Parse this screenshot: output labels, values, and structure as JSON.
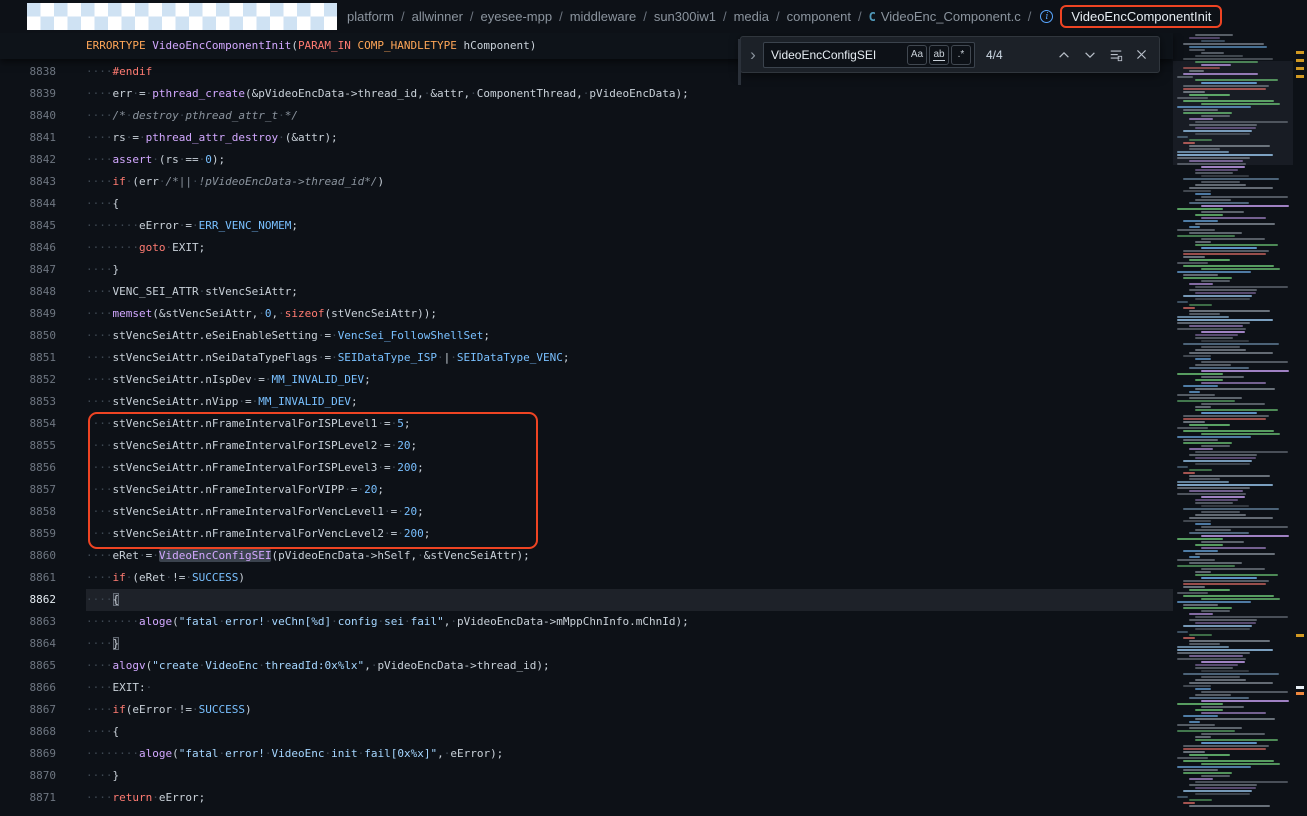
{
  "colors": {
    "background": "#0d1117",
    "annotation_orange": "#ee4423",
    "keyword": "#ff7b72",
    "function": "#d2a8ff",
    "constant": "#79c0ff",
    "string": "#a5d6ff",
    "comment": "#8b949e"
  },
  "topbar": {
    "separator": "/",
    "breadcrumb_items": [
      "platform",
      "allwinner",
      "eyesee-mpp",
      "middleware",
      "sun300iw1",
      "media",
      "component"
    ],
    "file": "VideoEnc_Component.c",
    "file_icon": "C",
    "symbol_icon": "i",
    "symbol": "VideoEncComponentInit"
  },
  "sticky_header": {
    "tokens": [
      [
        "t",
        "ERRORTYPE"
      ],
      [
        "d",
        " "
      ],
      [
        "f",
        "VideoEncComponentInit"
      ],
      [
        "d",
        "("
      ],
      [
        "k",
        "PARAM_IN"
      ],
      [
        "d",
        " "
      ],
      [
        "t",
        "COMP_HANDLETYPE"
      ],
      [
        "d",
        " hComponent)"
      ]
    ]
  },
  "find": {
    "query": "VideoEncConfigSEI",
    "matches": "4/4",
    "match_case": "Aa",
    "whole_word": "ab",
    "regex": ".*",
    "toggle_replace_glyph": "›"
  },
  "editor": {
    "current_line": 8862,
    "lines": [
      {
        "n": 8838,
        "t": [
          [
            "d",
            "    "
          ],
          [
            "k",
            "#endif"
          ]
        ]
      },
      {
        "n": 8839,
        "t": [
          [
            "d",
            "    err = "
          ],
          [
            "f",
            "pthread_create"
          ],
          [
            "d",
            "(&pVideoEncData->thread_id, &attr, ComponentThread, pVideoEncData);"
          ]
        ]
      },
      {
        "n": 8840,
        "t": [
          [
            "d",
            "    "
          ],
          [
            "c",
            "/* destroy pthread_attr_t */"
          ]
        ]
      },
      {
        "n": 8841,
        "t": [
          [
            "d",
            "    rs = "
          ],
          [
            "f",
            "pthread_attr_destroy"
          ],
          [
            "d",
            " (&attr);"
          ]
        ]
      },
      {
        "n": 8842,
        "t": [
          [
            "d",
            "    "
          ],
          [
            "f",
            "assert"
          ],
          [
            "d",
            " (rs == "
          ],
          [
            "n",
            "0"
          ],
          [
            "d",
            ");"
          ]
        ]
      },
      {
        "n": 8843,
        "t": [
          [
            "d",
            "    "
          ],
          [
            "k",
            "if"
          ],
          [
            "d",
            " (err "
          ],
          [
            "c",
            "/*|| !pVideoEncData->thread_id*/"
          ],
          [
            "d",
            ")"
          ]
        ]
      },
      {
        "n": 8844,
        "t": [
          [
            "d",
            "    {"
          ]
        ]
      },
      {
        "n": 8845,
        "t": [
          [
            "d",
            "        eError = "
          ],
          [
            "n",
            "ERR_VENC_NOMEM"
          ],
          [
            "d",
            ";"
          ]
        ]
      },
      {
        "n": 8846,
        "t": [
          [
            "d",
            "        "
          ],
          [
            "k",
            "goto"
          ],
          [
            "d",
            " EXIT;"
          ]
        ]
      },
      {
        "n": 8847,
        "t": [
          [
            "d",
            "    }"
          ]
        ]
      },
      {
        "n": 8848,
        "t": [
          [
            "d",
            "    VENC_SEI_ATTR stVencSeiAttr;"
          ]
        ]
      },
      {
        "n": 8849,
        "t": [
          [
            "d",
            "    "
          ],
          [
            "f",
            "memset"
          ],
          [
            "d",
            "(&stVencSeiAttr, "
          ],
          [
            "n",
            "0"
          ],
          [
            "d",
            ", "
          ],
          [
            "k",
            "sizeof"
          ],
          [
            "d",
            "(stVencSeiAttr));"
          ]
        ]
      },
      {
        "n": 8850,
        "t": [
          [
            "d",
            "    stVencSeiAttr.eSeiEnableSetting = "
          ],
          [
            "n",
            "VencSei_FollowShellSet"
          ],
          [
            "d",
            ";"
          ]
        ]
      },
      {
        "n": 8851,
        "t": [
          [
            "d",
            "    stVencSeiAttr.nSeiDataTypeFlags = "
          ],
          [
            "n",
            "SEIDataType_ISP"
          ],
          [
            "d",
            " | "
          ],
          [
            "n",
            "SEIDataType_VENC"
          ],
          [
            "d",
            ";"
          ]
        ]
      },
      {
        "n": 8852,
        "t": [
          [
            "d",
            "    stVencSeiAttr.nIspDev = "
          ],
          [
            "n",
            "MM_INVALID_DEV"
          ],
          [
            "d",
            ";"
          ]
        ]
      },
      {
        "n": 8853,
        "t": [
          [
            "d",
            "    stVencSeiAttr.nVipp = "
          ],
          [
            "n",
            "MM_INVALID_DEV"
          ],
          [
            "d",
            ";"
          ]
        ]
      },
      {
        "n": 8854,
        "t": [
          [
            "d",
            "    stVencSeiAttr.nFrameIntervalForISPLevel1 = "
          ],
          [
            "n",
            "5"
          ],
          [
            "d",
            ";"
          ]
        ]
      },
      {
        "n": 8855,
        "t": [
          [
            "d",
            "    stVencSeiAttr.nFrameIntervalForISPLevel2 = "
          ],
          [
            "n",
            "20"
          ],
          [
            "d",
            ";"
          ]
        ]
      },
      {
        "n": 8856,
        "t": [
          [
            "d",
            "    stVencSeiAttr.nFrameIntervalForISPLevel3 = "
          ],
          [
            "n",
            "200"
          ],
          [
            "d",
            ";"
          ]
        ]
      },
      {
        "n": 8857,
        "t": [
          [
            "d",
            "    stVencSeiAttr.nFrameIntervalForVIPP = "
          ],
          [
            "n",
            "20"
          ],
          [
            "d",
            ";"
          ]
        ]
      },
      {
        "n": 8858,
        "t": [
          [
            "d",
            "    stVencSeiAttr.nFrameIntervalForVencLevel1 = "
          ],
          [
            "n",
            "20"
          ],
          [
            "d",
            ";"
          ]
        ]
      },
      {
        "n": 8859,
        "t": [
          [
            "d",
            "    stVencSeiAttr.nFrameIntervalForVencLevel2 = "
          ],
          [
            "n",
            "200"
          ],
          [
            "d",
            ";"
          ]
        ]
      },
      {
        "n": 8860,
        "t": [
          [
            "d",
            "    eRet = "
          ],
          [
            "f m",
            "VideoEncConfigSEI"
          ],
          [
            "d",
            "(pVideoEncData->hSelf, &stVencSeiAttr);"
          ]
        ]
      },
      {
        "n": 8861,
        "t": [
          [
            "d",
            "    "
          ],
          [
            "k",
            "if"
          ],
          [
            "d",
            " (eRet != "
          ],
          [
            "n",
            "SUCCESS"
          ],
          [
            "d",
            ")"
          ]
        ]
      },
      {
        "n": 8862,
        "t": [
          [
            "d",
            "    "
          ],
          [
            "d bm",
            "{"
          ]
        ]
      },
      {
        "n": 8863,
        "t": [
          [
            "d",
            "        "
          ],
          [
            "f",
            "aloge"
          ],
          [
            "d",
            "("
          ],
          [
            "s",
            "\"fatal error! veChn[%d] config sei fail\""
          ],
          [
            "d",
            ", pVideoEncData->mMppChnInfo.mChnId);"
          ]
        ]
      },
      {
        "n": 8864,
        "t": [
          [
            "d",
            "    "
          ],
          [
            "d bm",
            "}"
          ]
        ]
      },
      {
        "n": 8865,
        "t": [
          [
            "d",
            "    "
          ],
          [
            "f",
            "alogv"
          ],
          [
            "d",
            "("
          ],
          [
            "s",
            "\"create VideoEnc threadId:0x%lx\""
          ],
          [
            "d",
            ", pVideoEncData->thread_id);"
          ]
        ]
      },
      {
        "n": 8866,
        "t": [
          [
            "d",
            "    EXIT: "
          ]
        ]
      },
      {
        "n": 8867,
        "t": [
          [
            "d",
            "    "
          ],
          [
            "k",
            "if"
          ],
          [
            "d",
            "(eError != "
          ],
          [
            "n",
            "SUCCESS"
          ],
          [
            "d",
            ")"
          ]
        ]
      },
      {
        "n": 8868,
        "t": [
          [
            "d",
            "    {"
          ]
        ]
      },
      {
        "n": 8869,
        "t": [
          [
            "d",
            "        "
          ],
          [
            "f",
            "aloge"
          ],
          [
            "d",
            "("
          ],
          [
            "s",
            "\"fatal error! VideoEnc init fail[0x%x]\""
          ],
          [
            "d",
            ", eError);"
          ]
        ]
      },
      {
        "n": 8870,
        "t": [
          [
            "d",
            "    }"
          ]
        ]
      },
      {
        "n": 8871,
        "t": [
          [
            "d",
            "    "
          ],
          [
            "k",
            "return"
          ],
          [
            "d",
            " eError;"
          ]
        ]
      }
    ]
  }
}
